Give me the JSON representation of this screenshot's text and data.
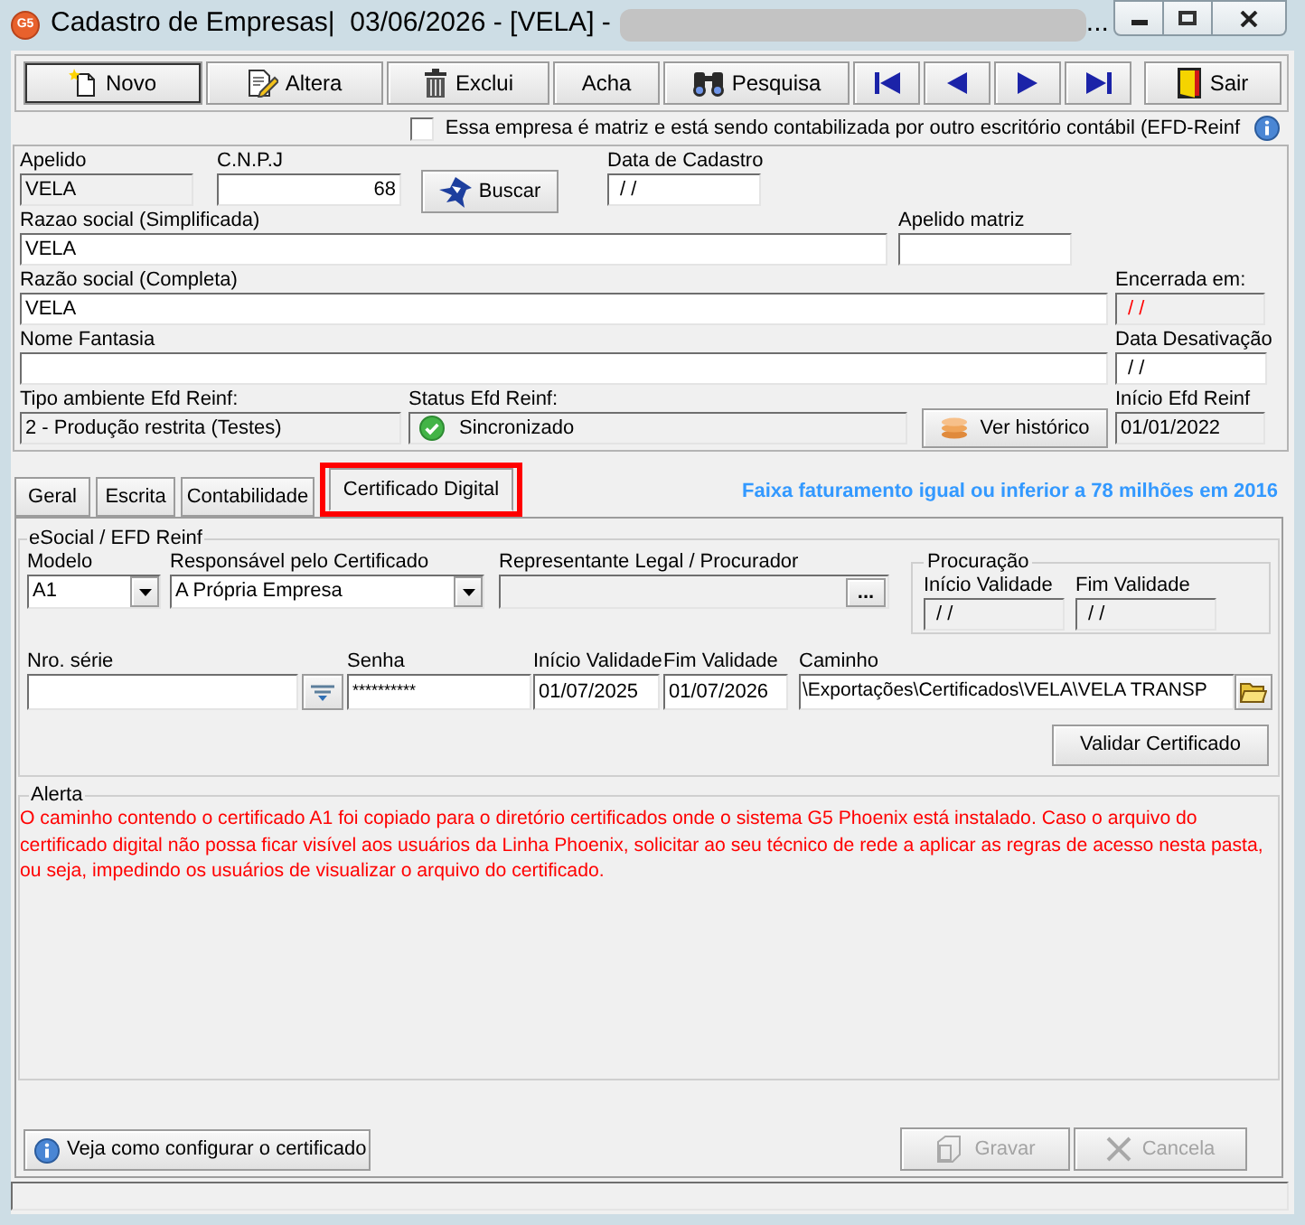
{
  "window": {
    "app_badge": "G5",
    "title": "Cadastro de Empresas|  03/06/2026 - [VELA] -",
    "title_tail": "..."
  },
  "toolbar": [
    {
      "kind": "new",
      "label": "Novo",
      "focused": true
    },
    {
      "kind": "edit",
      "label": "Altera",
      "focused": false
    },
    {
      "kind": "delete",
      "label": "Exclui",
      "focused": false
    },
    {
      "kind": "find",
      "label": "Acha",
      "focused": false
    },
    {
      "kind": "search",
      "label": "Pesquisa",
      "focused": false
    },
    {
      "kind": "first",
      "focused": false
    },
    {
      "kind": "previous",
      "focused": false
    },
    {
      "kind": "next",
      "focused": false
    },
    {
      "kind": "last",
      "focused": false
    },
    {
      "kind": "exit",
      "label": "Sair",
      "focused": false
    }
  ],
  "matrix_checkbox": {
    "label": "Essa empresa é matriz e está sendo contabilizada por outro escritório contábil (EFD-Reinf",
    "checked": false
  },
  "company": {
    "apelido": {
      "label": "Apelido",
      "value": "VELA",
      "disabled": true
    },
    "cnpj": {
      "label": "C.N.P.J",
      "value": "68",
      "disabled": false
    },
    "search_button": "Buscar",
    "data_cadastro": {
      "label": "Data de Cadastro",
      "value": "/ /",
      "disabled": false
    },
    "razao_simplificada": {
      "label": "Razao social (Simplificada)",
      "value": "VELA",
      "disabled": false
    },
    "apelido_matriz": {
      "label": "Apelido matriz",
      "disabled": false
    },
    "razao_completa": {
      "label": "Razão social (Completa)",
      "value": "VELA",
      "disabled": false
    },
    "encerrada_em": {
      "label": "Encerrada em:",
      "value": "/ /",
      "disabled": true
    },
    "nome_fantasia": {
      "label": "Nome Fantasia",
      "disabled": false
    },
    "data_desativacao": {
      "label": "Data Desativação",
      "value": "/ /",
      "disabled": false
    },
    "tipo_ambiente": {
      "label": "Tipo ambiente Efd Reinf:",
      "value": "2 - Produção restrita (Testes)",
      "disabled": true
    },
    "status": {
      "label": "Status Efd Reinf:",
      "value": "Sincronizado",
      "synced": true,
      "disabled": true
    },
    "history_button": "Ver histórico",
    "inicio_efd": {
      "label": "Início Efd Reinf",
      "value": "01/01/2022",
      "disabled": true
    }
  },
  "tabs": [
    {
      "label": "Geral",
      "selected": false,
      "highlighted": false
    },
    {
      "label": "Escrita",
      "selected": false,
      "highlighted": false
    },
    {
      "label": "Contabilidade",
      "selected": false,
      "highlighted": false
    },
    {
      "label": "Certificado Digital",
      "selected": true,
      "highlighted": true
    }
  ],
  "tax_notice": "Faixa faturamento igual ou inferior a 78 milhões em 2016",
  "certificate": {
    "group_title": "eSocial / EFD Reinf",
    "modelo": {
      "label": "Modelo",
      "value": "A1"
    },
    "responsavel": {
      "label": "Responsável pelo Certificado",
      "value": "A Própria Empresa"
    },
    "representante": {
      "label": "Representante Legal / Procurador",
      "disabled": true,
      "button": "..."
    },
    "procuracao": {
      "title": "Procuração",
      "inicio": {
        "label": "Início Validade",
        "value": "/ /",
        "disabled": true
      },
      "fim": {
        "label": "Fim Validade",
        "value": "/ /",
        "disabled": true
      }
    },
    "nro_serie": {
      "label": "Nro. série",
      "disabled": false
    },
    "senha": {
      "label": "Senha",
      "value": "**********",
      "disabled": false
    },
    "inicio_validade": {
      "label": "Início Validade",
      "value": "01/07/2025",
      "disabled": false
    },
    "fim_validade": {
      "label": "Fim Validade",
      "value": "01/07/2026",
      "disabled": false
    },
    "caminho": {
      "label": "Caminho",
      "value": "\\Exportações\\Certificados\\VELA\\VELA TRANSP",
      "disabled": false
    },
    "validate_button": "Validar Certificado"
  },
  "alert": {
    "title": "Alerta",
    "text": "O caminho contendo o certificado A1 foi copiado para o diretório certificados onde o sistema G5 Phoenix está instalado. Caso o arquivo do certificado digital não possa ficar visível aos usuários da Linha Phoenix, solicitar ao seu técnico de rede a aplicar as regras de acesso nesta pasta, ou seja, impedindo os usuários de visualizar o arquivo do certificado."
  },
  "footer": {
    "help_button": "Veja como configurar o certificado",
    "save": {
      "label": "Gravar",
      "disabled": true
    },
    "cancel": {
      "label": "Cancela",
      "disabled": true
    }
  }
}
